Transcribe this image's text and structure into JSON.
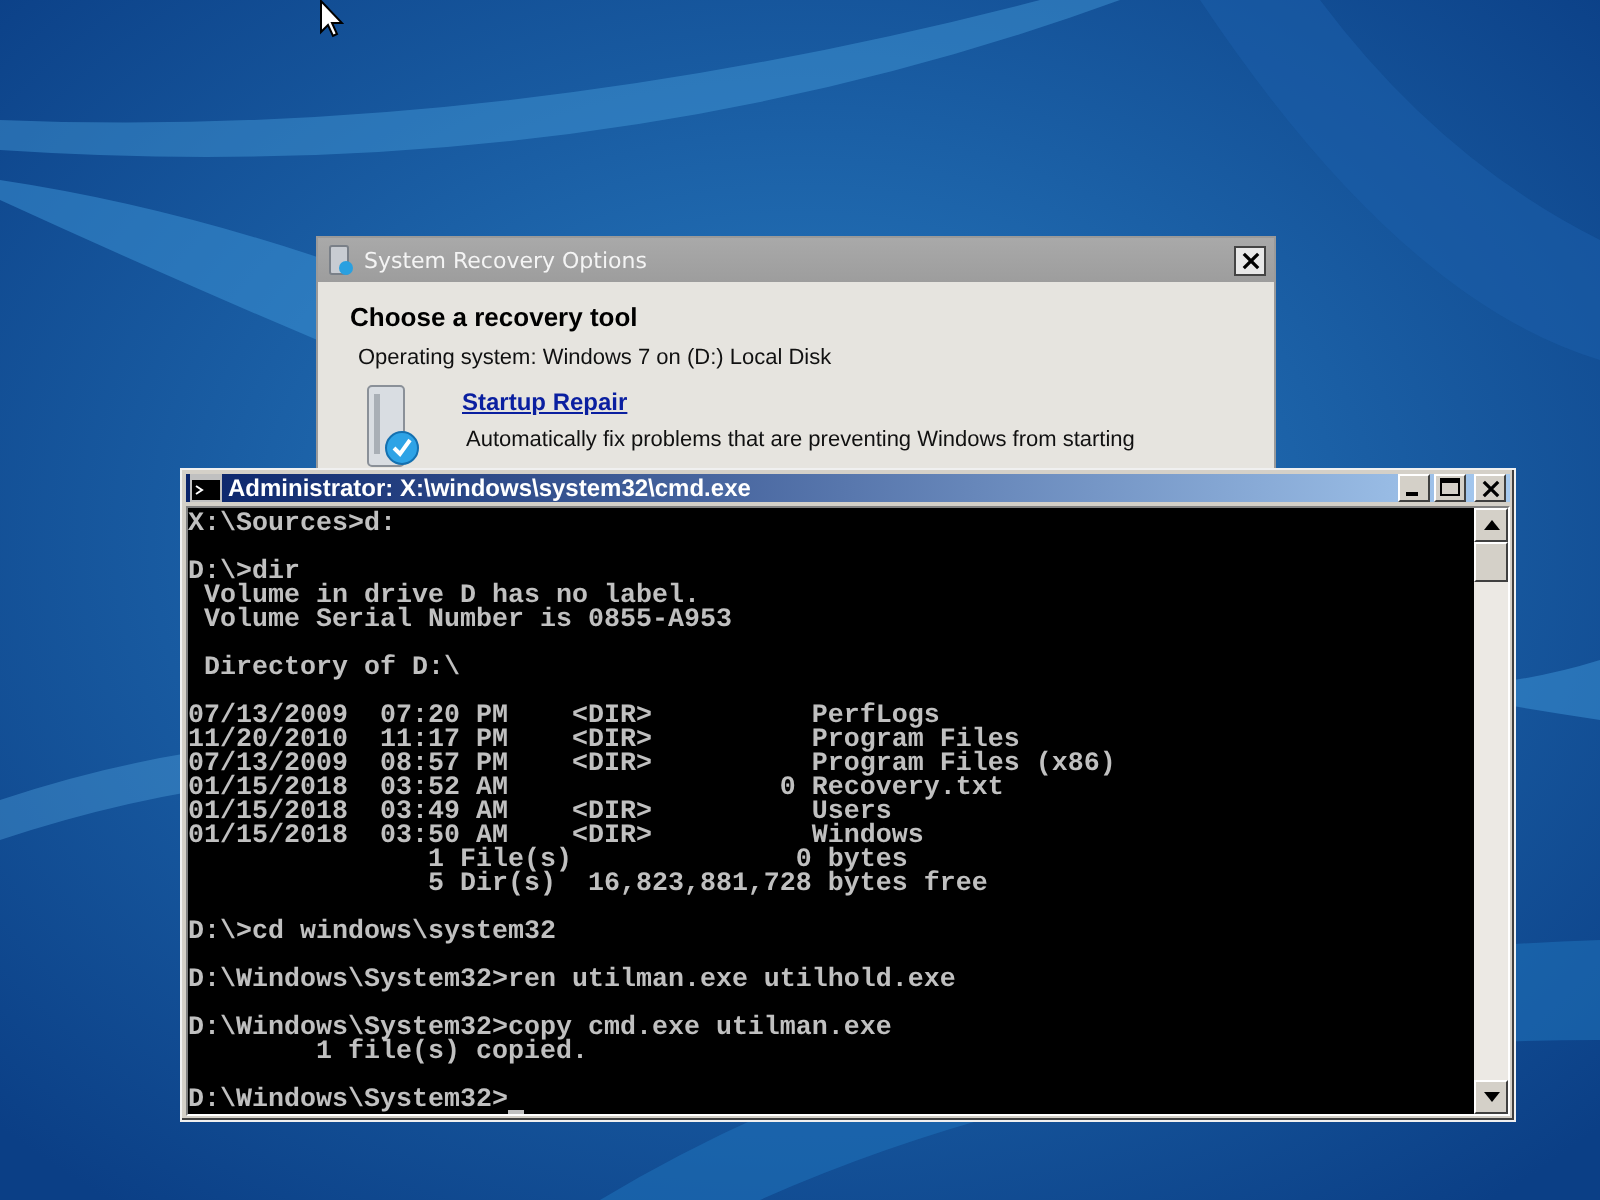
{
  "dialog": {
    "title": "System Recovery Options",
    "heading": "Choose a recovery tool",
    "os_line": "Operating system: Windows 7 on (D:) Local Disk",
    "tools": [
      {
        "name": "Startup Repair",
        "description": "Automatically fix problems that are preventing Windows from starting"
      }
    ]
  },
  "console": {
    "title": "Administrator: X:\\windows\\system32\\cmd.exe",
    "blocks": [
      [
        "X:\\Sources>d:"
      ],
      [
        "D:\\>dir",
        " Volume in drive D has no label.",
        " Volume Serial Number is 0855-A953"
      ],
      [
        " Directory of D:\\"
      ],
      [
        "07/13/2009  07:20 PM    <DIR>          PerfLogs",
        "11/20/2010  11:17 PM    <DIR>          Program Files",
        "07/13/2009  08:57 PM    <DIR>          Program Files (x86)",
        "01/15/2018  03:52 AM                 0 Recovery.txt",
        "01/15/2018  03:49 AM    <DIR>          Users",
        "01/15/2018  03:50 AM    <DIR>          Windows",
        "               1 File(s)              0 bytes",
        "               5 Dir(s)  16,823,881,728 bytes free"
      ],
      [
        "D:\\>cd windows\\system32"
      ],
      [
        "D:\\Windows\\System32>ren utilman.exe utilhold.exe"
      ],
      [
        "D:\\Windows\\System32>copy cmd.exe utilman.exe",
        "        1 file(s) copied."
      ],
      [
        "D:\\Windows\\System32>"
      ]
    ]
  }
}
